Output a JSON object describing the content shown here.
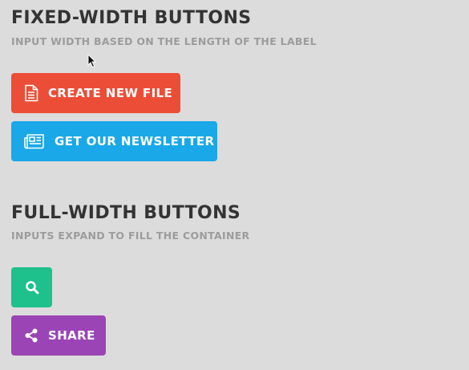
{
  "fixed_section": {
    "title": "FIXED-WIDTH BUTTONS",
    "subtitle": "INPUT WIDTH BASED ON THE LENGTH OF THE LABEL",
    "buttons": [
      {
        "label": "CREATE NEW FILE",
        "icon": "file-icon",
        "color": "#ec4d37"
      },
      {
        "label": "GET OUR NEWSLETTER",
        "icon": "newspaper-icon",
        "color": "#1aa8e8"
      }
    ]
  },
  "full_section": {
    "title": "FULL-WIDTH BUTTONS",
    "subtitle": "INPUTS EXPAND TO FILL THE CONTAINER",
    "buttons": [
      {
        "label": "",
        "icon": "search-icon",
        "color": "#1ec08c"
      },
      {
        "label": "SHARE",
        "icon": "share-icon",
        "color": "#9b44b5"
      }
    ]
  },
  "colors": {
    "background": "#dcdcdc",
    "title": "#333333",
    "subtitle": "#9c9c9c"
  }
}
